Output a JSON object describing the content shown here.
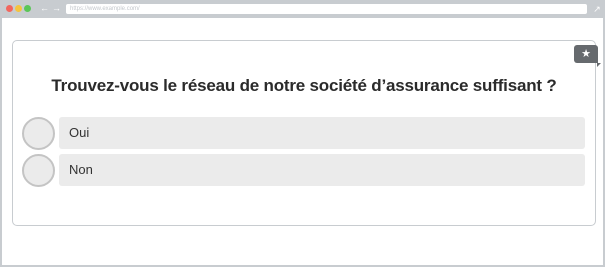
{
  "browser": {
    "url": "https://www.example.com/",
    "back_icon": "arrow-left-icon",
    "forward_icon": "arrow-right-icon",
    "expand_icon": "expand-icon",
    "colors": {
      "chrome": "#c8ccd0",
      "red": "#f2675f",
      "yellow": "#f5c440",
      "green": "#5bc658"
    }
  },
  "survey": {
    "bookmark_icon": "star-icon",
    "question": "Trouvez-vous le réseau de notre société d’assurance suffisant ?",
    "options": [
      {
        "label": "Oui",
        "selected": false
      },
      {
        "label": "Non",
        "selected": false
      }
    ],
    "colors": {
      "option_bg": "#ebebeb",
      "badge": "#666a6e"
    }
  }
}
